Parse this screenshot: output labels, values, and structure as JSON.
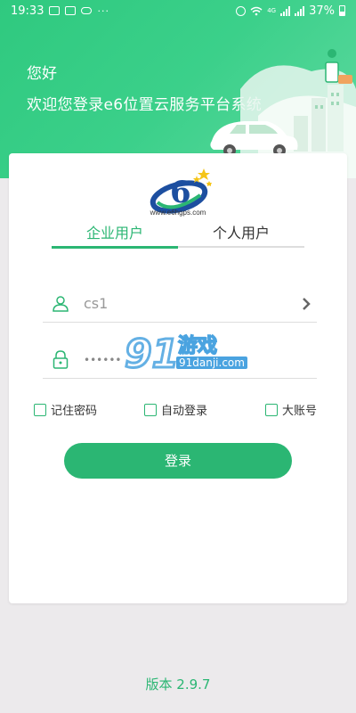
{
  "status_bar": {
    "time": "19:33",
    "dots": "···",
    "network": "4G",
    "battery": "37%"
  },
  "header": {
    "greeting": "您好",
    "welcome": "欢迎您登录e6位置云服务平台系统"
  },
  "logo": {
    "url_text": "www.e6hgps.com"
  },
  "tabs": [
    {
      "label": "企业用户",
      "active": true
    },
    {
      "label": "个人用户",
      "active": false
    }
  ],
  "form": {
    "username_value": "cs1",
    "password_value": "••••••"
  },
  "options": [
    {
      "label": "记住密码",
      "checked": false
    },
    {
      "label": "自动登录",
      "checked": false
    },
    {
      "label": "大账号",
      "checked": false
    }
  ],
  "login_label": "登录",
  "watermark": {
    "brand": "游戏",
    "site": "91danji.com"
  },
  "version": "版本 2.9.7",
  "colors": {
    "accent": "#2bb673",
    "header": "#3bd08a"
  }
}
